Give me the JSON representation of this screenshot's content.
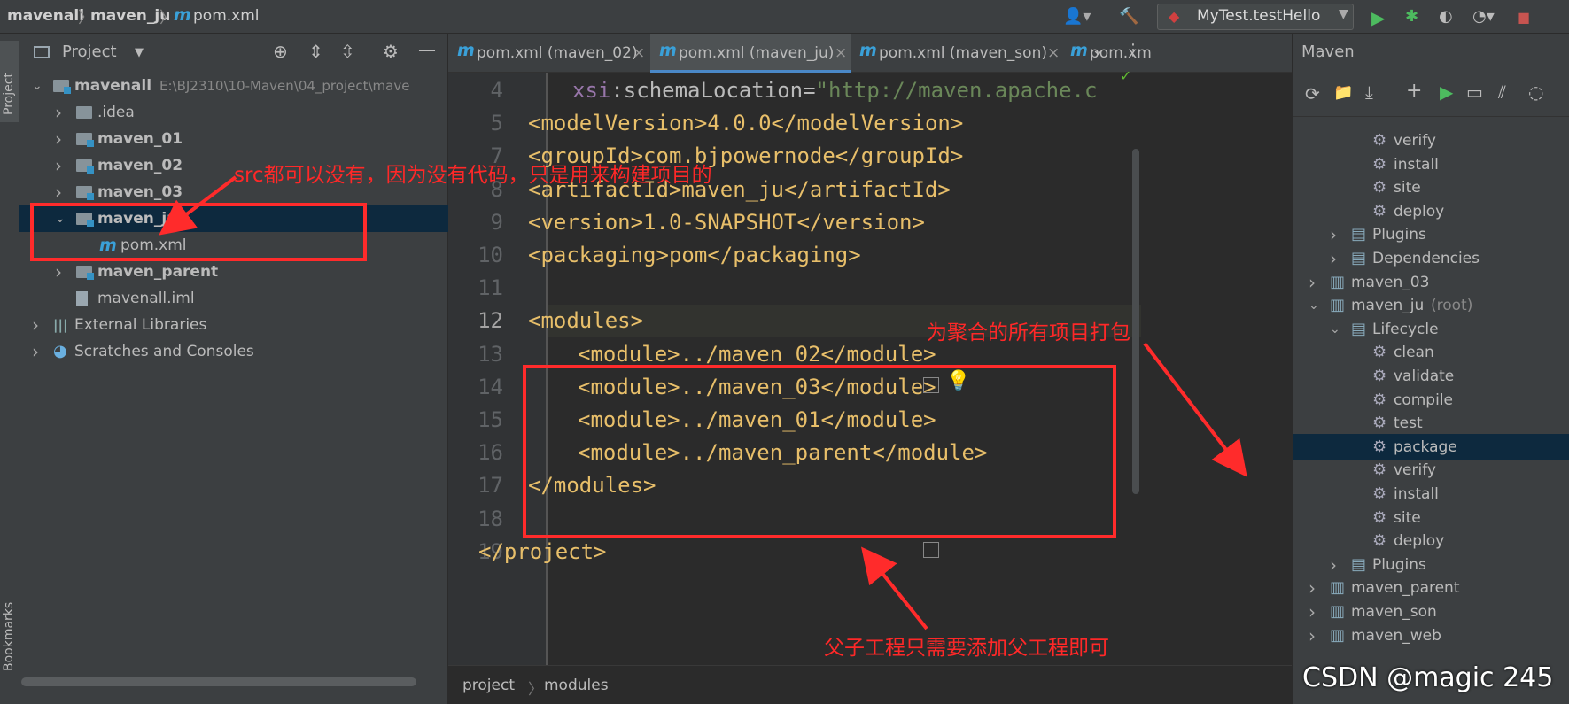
{
  "topbar": {
    "breadcrumb": [
      "mavenall",
      "maven_ju",
      "pom.xml"
    ],
    "run_config": "MyTest.testHello"
  },
  "left_stripe": {
    "project_label": "Project",
    "bookmarks_label": "Bookmarks"
  },
  "project_panel": {
    "title": "Project",
    "tree": [
      {
        "label": "mavenall",
        "path": "E:\\BJ2310\\10-Maven\\04_project\\mave",
        "depth": 0,
        "expanded": true,
        "bold": true,
        "icon": "module-folder-icon"
      },
      {
        "label": ".idea",
        "depth": 1,
        "expanded": false,
        "bold": false,
        "icon": "folder-icon"
      },
      {
        "label": "maven_01",
        "depth": 1,
        "expanded": false,
        "bold": true,
        "icon": "module-folder-icon"
      },
      {
        "label": "maven_02",
        "depth": 1,
        "expanded": false,
        "bold": true,
        "icon": "module-folder-icon"
      },
      {
        "label": "maven_03",
        "depth": 1,
        "expanded": false,
        "bold": true,
        "icon": "module-folder-icon"
      },
      {
        "label": "maven_ju",
        "depth": 1,
        "expanded": true,
        "bold": true,
        "selected": true,
        "icon": "module-folder-icon"
      },
      {
        "label": "pom.xml",
        "depth": 2,
        "bold": false,
        "icon": "maven-file-icon"
      },
      {
        "label": "maven_parent",
        "depth": 1,
        "expanded": false,
        "bold": true,
        "icon": "module-folder-icon"
      },
      {
        "label": "mavenall.iml",
        "depth": 1,
        "bold": false,
        "icon": "iml-file-icon"
      },
      {
        "label": "External Libraries",
        "depth": 0,
        "expanded": false,
        "bold": false,
        "icon": "library-icon"
      },
      {
        "label": "Scratches and Consoles",
        "depth": 0,
        "expanded": false,
        "bold": false,
        "icon": "scratches-icon"
      }
    ]
  },
  "editor": {
    "tabs": [
      {
        "label": "pom.xml (maven_02)",
        "active": false
      },
      {
        "label": "pom.xml (maven_ju)",
        "active": true
      },
      {
        "label": "pom.xml (maven_son)",
        "active": false
      },
      {
        "label": "pom.xm",
        "active": false
      }
    ],
    "lines": [
      {
        "n": "4",
        "code": "xsi:schemaLocation=\"http://maven.apache.c"
      },
      {
        "n": "5",
        "code": "<modelVersion>4.0.0</modelVersion>"
      },
      {
        "n": "7",
        "code": "<groupId>com.bjpowernode</groupId>"
      },
      {
        "n": "8",
        "code": "<artifactId>maven_ju</artifactId>"
      },
      {
        "n": "9",
        "code": "<version>1.0-SNAPSHOT</version>"
      },
      {
        "n": "10",
        "code": "<packaging>pom</packaging>"
      },
      {
        "n": "11",
        "code": ""
      },
      {
        "n": "12",
        "code": "<modules>"
      },
      {
        "n": "13",
        "code": "<module>../maven_02</module>"
      },
      {
        "n": "14",
        "code": "<module>../maven_03</module>"
      },
      {
        "n": "15",
        "code": "<module>../maven_01</module>"
      },
      {
        "n": "16",
        "code": "<module>../maven_parent</module>"
      },
      {
        "n": "17",
        "code": "</modules>"
      },
      {
        "n": "18",
        "code": ""
      },
      {
        "n": "19",
        "code": "</project>"
      }
    ],
    "breadcrumb": [
      "project",
      "modules"
    ]
  },
  "maven_panel": {
    "title": "Maven",
    "items": [
      {
        "label": "verify",
        "type": "goal"
      },
      {
        "label": "install",
        "type": "goal"
      },
      {
        "label": "site",
        "type": "goal"
      },
      {
        "label": "deploy",
        "type": "goal"
      },
      {
        "label": "Plugins",
        "type": "group"
      },
      {
        "label": "Dependencies",
        "type": "group"
      },
      {
        "label": "maven_03",
        "type": "project"
      },
      {
        "label": "maven_ju",
        "suffix": "(root)",
        "type": "project"
      },
      {
        "label": "Lifecycle",
        "type": "group"
      },
      {
        "label": "clean",
        "type": "goal"
      },
      {
        "label": "validate",
        "type": "goal"
      },
      {
        "label": "compile",
        "type": "goal"
      },
      {
        "label": "test",
        "type": "goal"
      },
      {
        "label": "package",
        "type": "goal",
        "selected": true
      },
      {
        "label": "verify",
        "type": "goal"
      },
      {
        "label": "install",
        "type": "goal"
      },
      {
        "label": "site",
        "type": "goal"
      },
      {
        "label": "deploy",
        "type": "goal"
      },
      {
        "label": "Plugins",
        "type": "group"
      },
      {
        "label": "maven_parent",
        "type": "project"
      },
      {
        "label": "maven_son",
        "type": "project"
      },
      {
        "label": "maven_web",
        "type": "project"
      }
    ]
  },
  "annotations": {
    "src_note": "src都可以没有，因为没有代码，只是用来构建项目的",
    "package_note": "为聚合的所有项目打包",
    "parent_note": "父子工程只需要添加父工程即可",
    "color": "#ff2b2b"
  },
  "watermark": "CSDN @magic 245"
}
